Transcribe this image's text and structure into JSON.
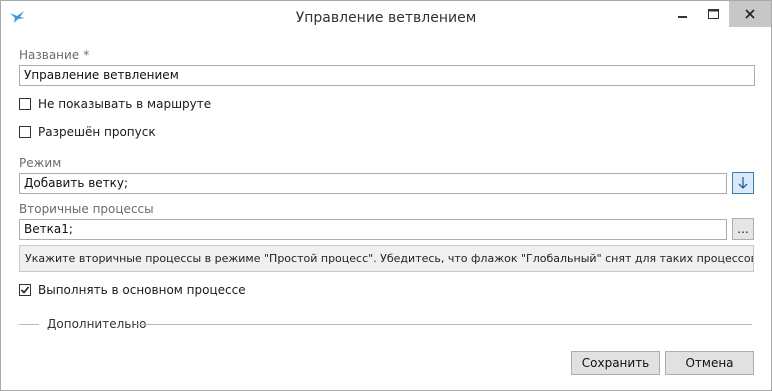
{
  "window": {
    "title": "Управление ветвлением"
  },
  "form": {
    "name": {
      "label": "Название",
      "required_mark": "*",
      "value": "Управление ветвлением"
    },
    "hide_in_route": {
      "label": "Не показывать в маршруте",
      "checked": false
    },
    "skip_allowed": {
      "label": "Разрешён пропуск",
      "checked": false
    },
    "mode": {
      "label": "Режим",
      "value": "Добавить ветку;"
    },
    "secondary": {
      "label": "Вторичные процессы",
      "value": "Ветка1;",
      "browse_label": "..."
    },
    "hint": "Укажите вторичные процессы в режиме \"Простой процесс\". Убедитесь, что флажок \"Глобальный\" снят для таких процессов.",
    "run_in_main": {
      "label": "Выполнять в основном процессе",
      "checked": true
    },
    "advanced_section": "Дополнительно"
  },
  "buttons": {
    "save": "Сохранить",
    "cancel": "Отмена"
  }
}
